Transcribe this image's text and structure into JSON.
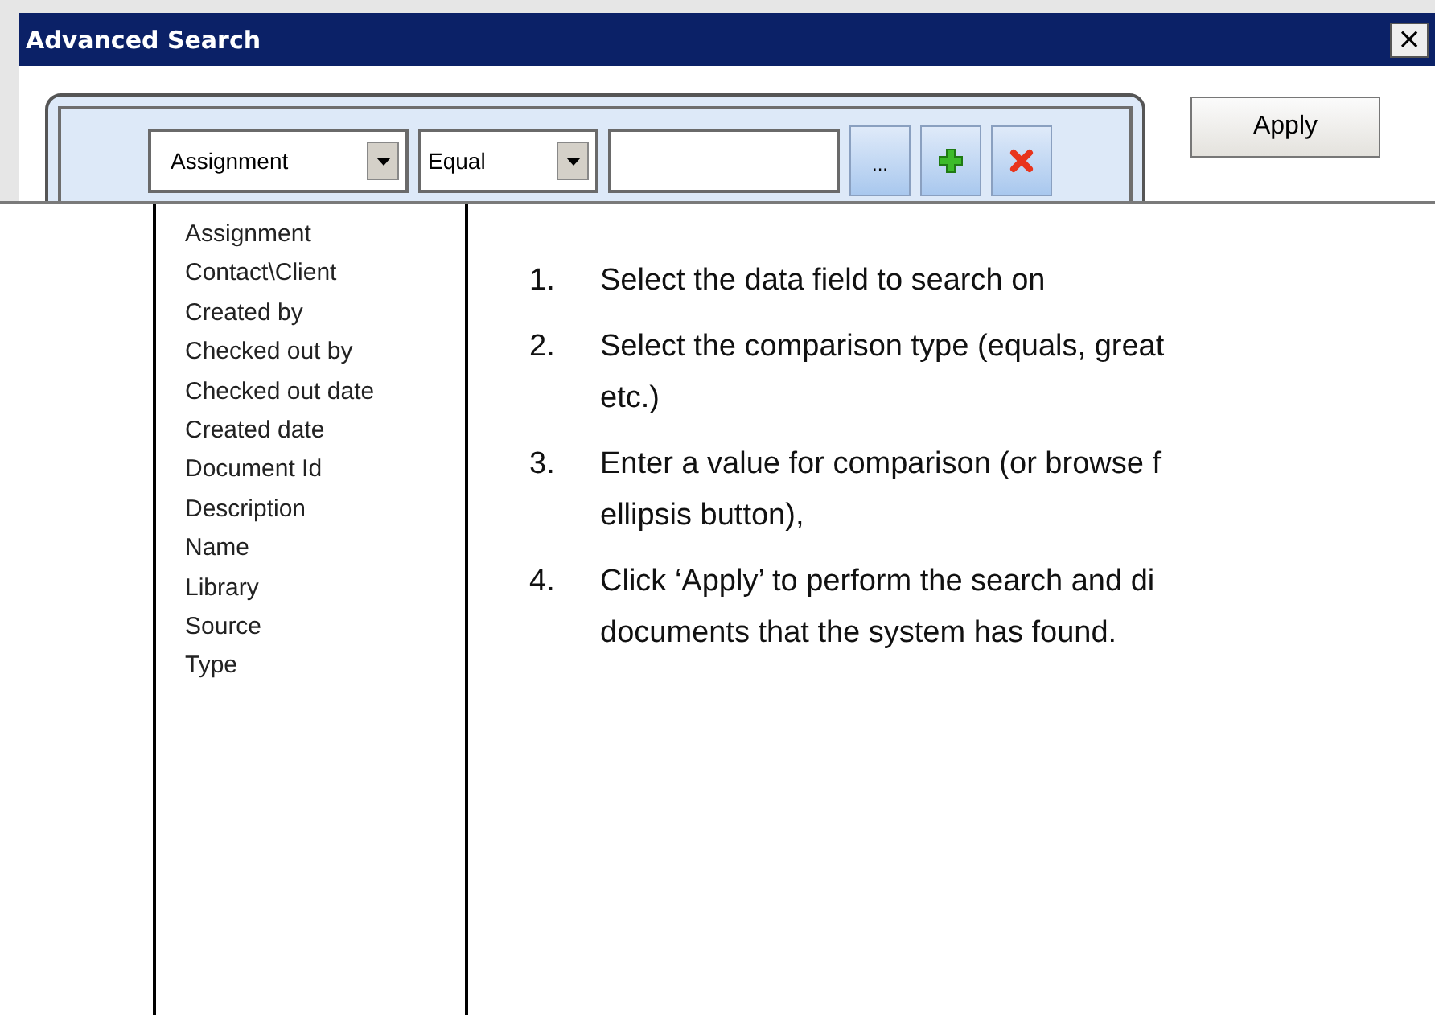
{
  "window": {
    "title": "Advanced Search",
    "close": "×"
  },
  "filter": {
    "field": "Assignment",
    "operator": "Equal",
    "browse": "...",
    "apply": "Apply"
  },
  "dropdown": {
    "items": [
      {
        "label": "Assignment"
      },
      {
        "label": "Contact\\Client"
      },
      {
        "label": "Created by"
      },
      {
        "label": "Checked out by"
      },
      {
        "label": "Checked out date"
      },
      {
        "label": "Created date"
      },
      {
        "label": "Document Id"
      },
      {
        "label": "Description"
      },
      {
        "label": "Name"
      },
      {
        "label": "Library"
      },
      {
        "label": "Source"
      },
      {
        "label": "Type"
      }
    ]
  },
  "steps": [
    {
      "number": "1.",
      "lines": [
        "Select the data field to search on"
      ]
    },
    {
      "number": "2.",
      "lines": [
        "Select the comparison type (equals, great",
        "etc.)"
      ]
    },
    {
      "number": "3.",
      "lines": [
        "Enter a value for comparison (or browse f",
        "ellipsis button),"
      ]
    },
    {
      "number": "4.",
      "lines": [
        "Click ‘Apply’ to perform the search and di",
        "documents that the system has found."
      ]
    }
  ]
}
